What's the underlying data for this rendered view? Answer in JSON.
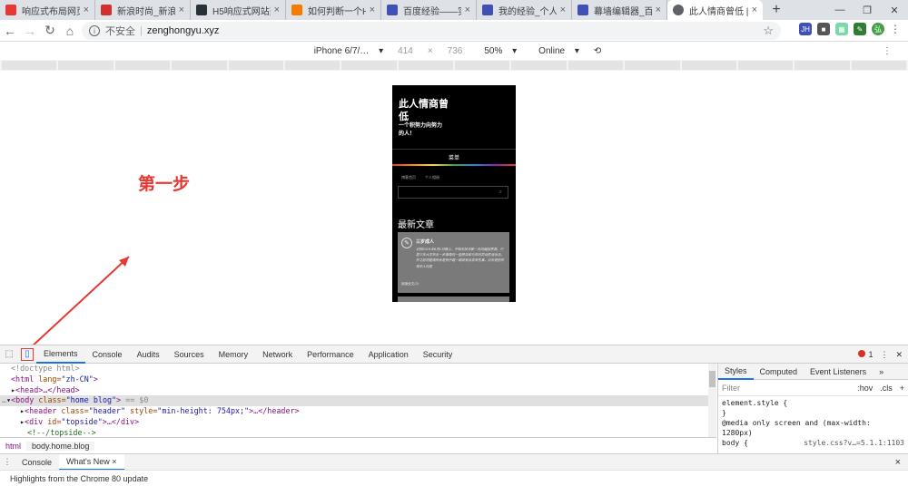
{
  "tabs": [
    {
      "title": "响应式布局网页_百…",
      "color": "#e53935"
    },
    {
      "title": "新浪时尚_新浪网",
      "color": "#d32f2f"
    },
    {
      "title": "H5响应式网站建设…",
      "color": "#263238"
    },
    {
      "title": "如何判断一个H5页…",
      "color": "#f57c00"
    },
    {
      "title": "百度经验——实用…",
      "color": "#3f51b5"
    },
    {
      "title": "我的经验_个人中心…",
      "color": "#3f51b5"
    },
    {
      "title": "幕墙编辑器_百度经…",
      "color": "#3f51b5"
    },
    {
      "title": "此人情商曾低 | 一…",
      "color": "#5f6368"
    }
  ],
  "toolbar": {
    "insecure": "不安全",
    "separator": "|",
    "url": "zenghongyu.xyz"
  },
  "device": {
    "name": "iPhone 6/7/…",
    "width": "414",
    "times": "×",
    "height": "736",
    "zoom": "50%",
    "network": "Online"
  },
  "site": {
    "title": "此人情商曾低",
    "subtitle": "一个积努力向努力的人！",
    "menu": "菜单",
    "link1": "博客首页",
    "link2": "个人相册",
    "newest": "最新文章",
    "post_title": "三岁成人",
    "post_body": "记得2019年6月1日晚上，不知天技术那一天的越回京高。只是三年大学毕业一步事情的一些想法和与世的异动生活信息。并之前问题现所会是得于越一眼成有自去来生真。对天是别作现年人的是",
    "post_more": "阅读全文(2)"
  },
  "annotation": "第一步",
  "devtools": {
    "tabs": [
      "Elements",
      "Console",
      "Audits",
      "Sources",
      "Memory",
      "Network",
      "Performance",
      "Application",
      "Security"
    ],
    "error_count": "1",
    "lines": {
      "doctype": "<!doctype html>",
      "html_open": "<html ",
      "html_attr": "lang=",
      "html_val": "\"zh-CN\"",
      "html_close": ">",
      "head": "<head>…</head>",
      "body_open": "<body ",
      "body_attr": "class=",
      "body_val": "\"home blog\"",
      "body_close": ">",
      "body_eq": " == $0",
      "header_open": "<header ",
      "header_attr1": "class=",
      "header_val1": "\"header\"",
      "header_attr2": " style=",
      "header_val2": "\"min-height: 754px;\"",
      "header_close": ">…</header>",
      "div_open": "<div ",
      "div_attr": "id=",
      "div_val": "\"topside\"",
      "div_close": ">…</div>",
      "comment": "<!--/topside-->"
    },
    "breadcrumbs": [
      "html",
      "body.home.blog"
    ],
    "styles_tabs": [
      "Styles",
      "Computed",
      "Event Listeners",
      "»"
    ],
    "filter_placeholder": "Filter",
    "hov": ":hov",
    "cls": ".cls",
    "add": "+",
    "rule1": "element.style {",
    "rule1_end": "}",
    "rule2": "@media only screen and (max-width:",
    "rule2b": "1280px)",
    "rule3": "body {",
    "rule3_src": "style.css?v…=5.1.1:1103",
    "drawer_tabs": [
      "Console",
      "What's New"
    ],
    "drawer_close": "×",
    "drawer_text": "Highlights from the Chrome 80 update"
  }
}
